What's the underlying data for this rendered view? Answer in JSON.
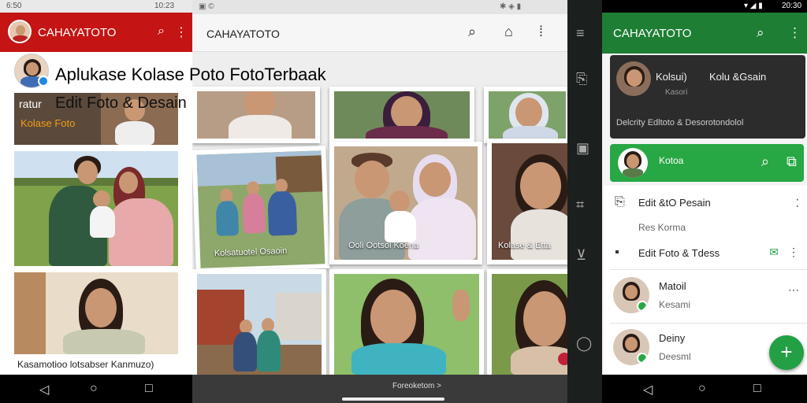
{
  "panel1": {
    "status": {
      "left_time": "6:50",
      "right_time": "10:23"
    },
    "app_title": "CAHAYATOTO",
    "card_line1_prefix": "ratur",
    "card_line2": "Kolase Foto",
    "bottom_caption": "Kasamotioo lotsabser Kanmuzo)"
  },
  "overlay": {
    "title": "Aplukase Kolase Poto FotoTerbaak",
    "subtitle": "Edit Foto & Desain"
  },
  "panel2": {
    "app_title": "CAHAYATOTO",
    "tile_captions": [
      "Kolsatuotel Osaoin",
      "Ooli Ootsol Koena",
      "Kolase & Etta"
    ],
    "bottom_text": "Foreoketom >"
  },
  "panel4": {
    "status_time": "20:30",
    "app_title": "CAHAYATOTO",
    "dark_card": {
      "title": "Kolu &Gsain",
      "name": "Kolsui)",
      "sub": "Kasori",
      "footer": "Delcrity Edltoto & Desorotondolol"
    },
    "green_card": {
      "label": "Kotoa"
    },
    "rows": [
      {
        "label": "Edit &tO Pesain",
        "sub": "Res Korma"
      },
      {
        "label": "Edit Foto & Tdess"
      }
    ],
    "contacts": [
      {
        "name": "Matoil",
        "sub": "Kesami"
      },
      {
        "name": "Deiny",
        "sub": "Deesml"
      }
    ],
    "fab_label": "+"
  },
  "icons": [
    "search-icon",
    "overflow-menu-icon",
    "lock-icon",
    "verified-badge-icon",
    "menu-icon",
    "inbox-icon",
    "square-icon",
    "focus-icon",
    "download-box-icon",
    "chat-icon",
    "mail-check-icon",
    "window-icon",
    "back-icon",
    "home-icon",
    "recents-icon",
    "add-icon"
  ],
  "colors": {
    "red_bar": "#c41414",
    "green_bar": "#1e7e34",
    "green_accent": "#28a745",
    "dark_rail": "#1b1f1d"
  }
}
